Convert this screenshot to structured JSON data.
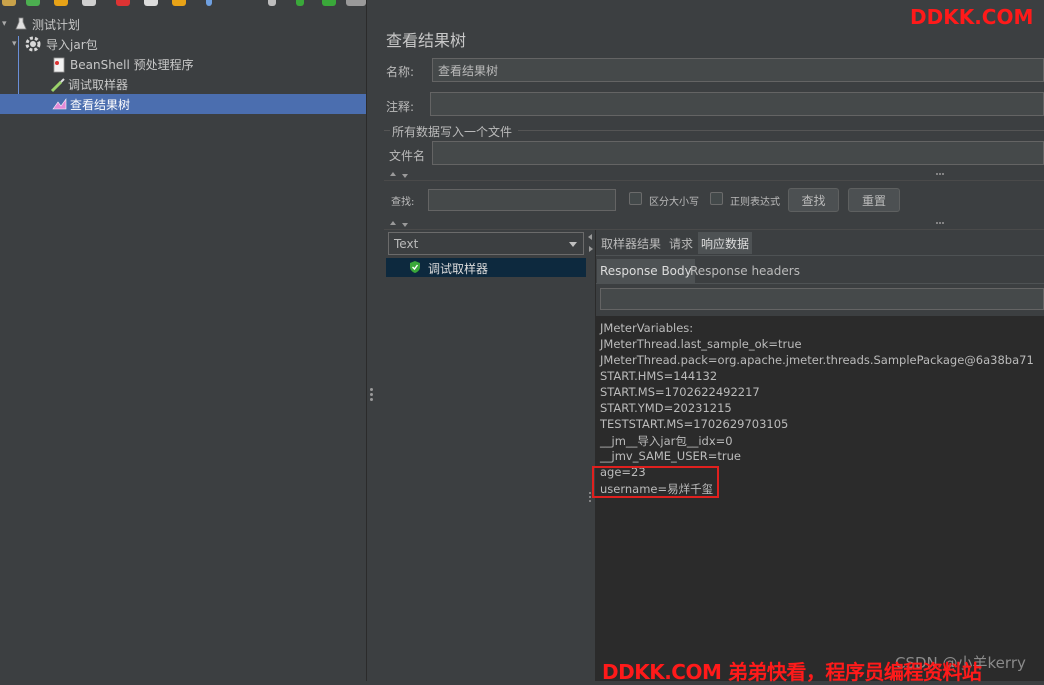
{
  "tree": {
    "items": [
      {
        "label": "测试计划"
      },
      {
        "label": "导入jar包"
      },
      {
        "label": "BeanShell 预处理程序"
      },
      {
        "label": "调试取样器"
      },
      {
        "label": "查看结果树"
      }
    ]
  },
  "panel": {
    "title": "查看结果树",
    "name_label": "名称:",
    "name_value": "查看结果树",
    "comment_label": "注释:",
    "comment_value": "",
    "file_group_label": "所有数据写入一个文件",
    "filename_label": "文件名",
    "filename_value": ""
  },
  "search": {
    "label": "查找:",
    "value": "",
    "case_sensitive_label": "区分大小写",
    "regex_label": "正则表达式",
    "find_button": "查找",
    "reset_button": "重置"
  },
  "results": {
    "renderer": "Text",
    "samples": [
      {
        "label": "调试取样器",
        "status": "success"
      }
    ]
  },
  "detail_tabs": {
    "tabs": [
      "取样器结果",
      "请求",
      "响应数据"
    ],
    "active": "响应数据",
    "subtabs": [
      "Response Body",
      "Response headers"
    ],
    "active_subtab": "Response Body"
  },
  "response_body": {
    "lines": [
      "JMeterVariables:",
      "JMeterThread.last_sample_ok=true",
      "JMeterThread.pack=org.apache.jmeter.threads.SamplePackage@6a38ba71",
      "START.HMS=144132",
      "START.MS=1702622492217",
      "START.YMD=20231215",
      "TESTSTART.MS=1702629703105",
      "__jm__导入jar包__idx=0",
      "__jmv_SAME_USER=true",
      "age=23",
      "username=易烊千玺"
    ]
  },
  "watermarks": {
    "top": "DDKK.COM",
    "bottom": "DDKK.COM 弟弟快看，程序员编程资料站",
    "csdn": "CSDN @小羊kerry"
  },
  "colors": {
    "background": "#3c3f41",
    "selection": "#4b6eaf",
    "content_bg": "#2b2b2b",
    "highlight_border": "#e0201e",
    "watermark": "#ff1a1a",
    "success": "#3aa83a"
  }
}
